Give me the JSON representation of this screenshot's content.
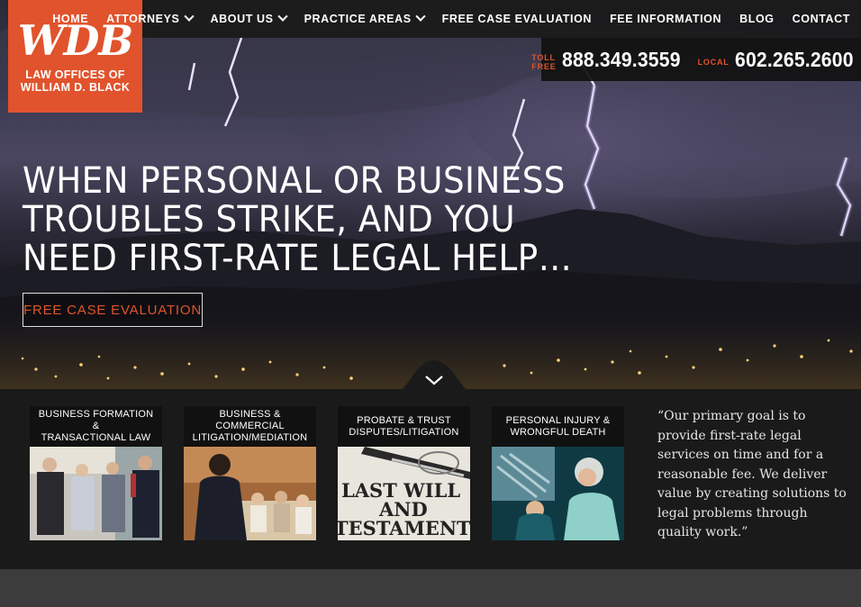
{
  "brand": {
    "logo_mark": "WDB",
    "logo_line1": "LAW OFFICES OF",
    "logo_line2": "WILLIAM D. BLACK",
    "accent_color": "#e0532c"
  },
  "nav": {
    "items": [
      {
        "label": "HOME",
        "dropdown": false
      },
      {
        "label": "ATTORNEYS",
        "dropdown": true
      },
      {
        "label": "ABOUT US",
        "dropdown": true
      },
      {
        "label": "PRACTICE AREAS",
        "dropdown": true
      },
      {
        "label": "FREE CASE EVALUATION",
        "dropdown": false
      },
      {
        "label": "FEE INFORMATION",
        "dropdown": false
      },
      {
        "label": "BLOG",
        "dropdown": false
      },
      {
        "label": "CONTACT",
        "dropdown": false
      }
    ]
  },
  "phones": {
    "toll_free_label": "TOLL FREE",
    "toll_free_number": "888.349.3559",
    "local_label": "LOCAL",
    "local_number": "602.265.2600"
  },
  "hero": {
    "headline_lines": [
      "WHEN PERSONAL OR BUSINESS",
      "TROUBLES STRIKE, AND YOU",
      "NEED FIRST-RATE LEGAL HELP…"
    ],
    "cta_label": "FREE CASE EVALUATION",
    "scroll_icon": "chevron-down-icon"
  },
  "practice_areas": [
    {
      "line1": "BUSINESS FORMATION &",
      "line2": "TRANSACTIONAL LAW"
    },
    {
      "line1": "BUSINESS & COMMERCIAL",
      "line2": "LITIGATION/MEDIATION"
    },
    {
      "line1": "PROBATE & TRUST",
      "line2": "DISPUTES/LITIGATION"
    },
    {
      "line1": "PERSONAL INJURY &",
      "line2": "WRONGFUL DEATH"
    }
  ],
  "card3_image_text": [
    "LAST WILL",
    "AND",
    "TESTAMENT"
  ],
  "quote": "“Our primary goal is to provide first-rate legal services on time and for a reasonable fee. We deliver value by creating solutions to legal problems through quality work.”"
}
